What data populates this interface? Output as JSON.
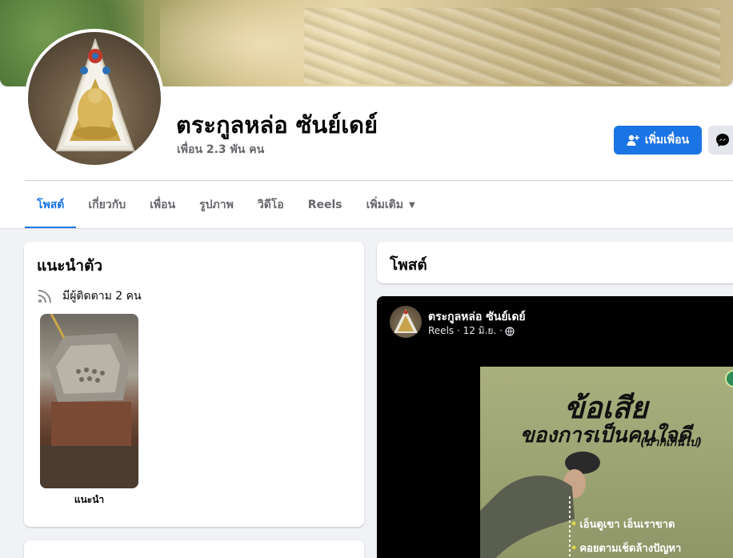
{
  "profile": {
    "name": "ตระกูลหล่อ ซันย์เดย์",
    "friends_count": "เพื่อน 2.3 พัน คน"
  },
  "actions": {
    "add_friend_label": "เพิ่มเพื่อน"
  },
  "tabs": [
    {
      "label": "โพสต์",
      "active": true
    },
    {
      "label": "เกี่ยวกับ",
      "active": false
    },
    {
      "label": "เพื่อน",
      "active": false
    },
    {
      "label": "รูปภาพ",
      "active": false
    },
    {
      "label": "วิดีโอ",
      "active": false
    },
    {
      "label": "Reels",
      "active": false
    },
    {
      "label": "เพิ่มเติม",
      "active": false
    }
  ],
  "intro": {
    "title": "แนะนำตัว",
    "followers": "มีผู้ติดตาม 2 คน",
    "featured_label": "แนะนำ"
  },
  "posts": {
    "title": "โพสต์"
  },
  "reel_post": {
    "author": "ตระกูลหล่อ ซันย์เดย์",
    "meta": "Reels · 12 มิ.ย. ·",
    "image_text": {
      "headline": "ข้อเสีย",
      "subheadline": "ของการเป็นคนใจดี",
      "note": "(มากเกินไป)",
      "bullet1": "เอ็นดูเขา เอ็นเราขาด",
      "bullet2": "คอยตามเช็ดล้างปัญหา"
    }
  },
  "colors": {
    "accent": "#1b74e4",
    "background": "#f0f2f5",
    "secondary_text": "#65676b"
  },
  "icons": {
    "add_friend": "person-plus-icon",
    "messenger": "messenger-icon",
    "followers": "rss-feed-icon",
    "privacy": "globe-icon",
    "more": "caret-down-icon"
  }
}
